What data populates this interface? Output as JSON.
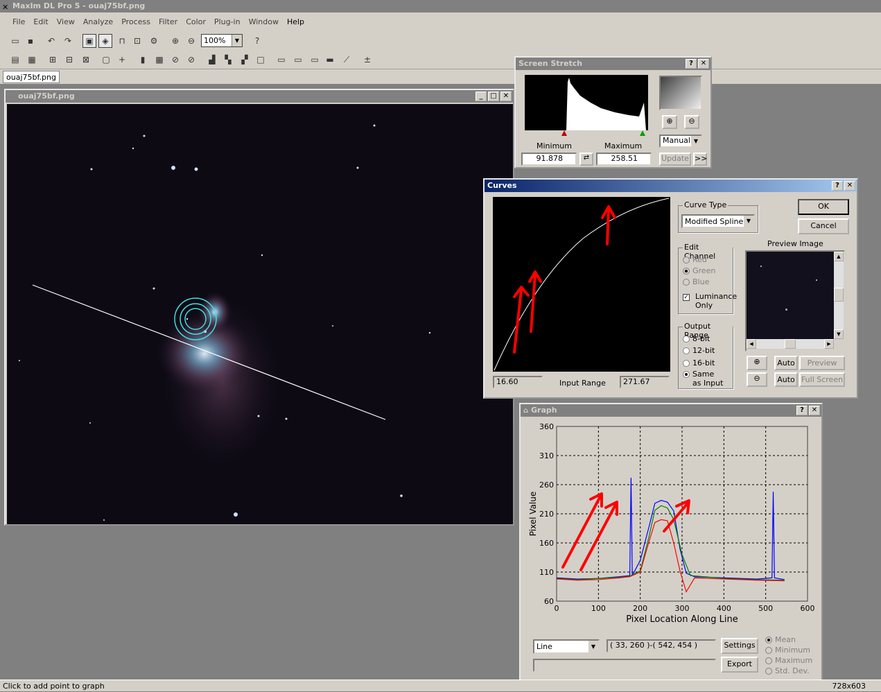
{
  "app": {
    "title": "MaxIm DL Pro 5 - ouaj75bf.png"
  },
  "menu": [
    "File",
    "Edit",
    "View",
    "Analyze",
    "Process",
    "Filter",
    "Color",
    "Plug-in",
    "Window",
    "Help"
  ],
  "toolbar": {
    "zoom": "100%"
  },
  "doc_tab": "ouaj75bf.png",
  "image_window": {
    "title": "ouaj75bf.png"
  },
  "screen_stretch": {
    "title": "Screen Stretch",
    "help": "?",
    "close": "✕",
    "min_label": "Minimum",
    "max_label": "Maximum",
    "min_value": "91.878",
    "max_value": "258.51",
    "mode": "Manual",
    "update": "Update",
    "more": ">>"
  },
  "curves": {
    "title": "Curves",
    "help": "?",
    "close": "✕",
    "curve_type_label": "Curve Type",
    "curve_type": "Modified Spline",
    "ok": "OK",
    "cancel": "Cancel",
    "edit_channel_label": "Edit Channel",
    "channels": [
      "Red",
      "Green",
      "Blue"
    ],
    "luminance_only": "Luminance Only",
    "luminance_line1": "Luminance",
    "luminance_line2": "Only",
    "output_range_label": "Output Range",
    "ranges": [
      "8-bit",
      "12-bit",
      "16-bit"
    ],
    "same_line1": "Same",
    "same_line2": "as Input",
    "preview_label": "Preview Image",
    "auto1": "Auto",
    "auto2": "Auto",
    "preview_btn": "Preview",
    "fullscreen_btn": "Full Screen",
    "input_min": "16.60",
    "input_range_label": "Input Range",
    "input_max": "271.67"
  },
  "graph": {
    "title": "Graph",
    "help": "?",
    "close": "✕",
    "mode": "Line",
    "coords": "( 33, 260 )-( 542, 454 )",
    "settings": "Settings",
    "export": "Export",
    "stats": [
      "Mean",
      "Minimum",
      "Maximum",
      "Std. Dev."
    ]
  },
  "chart_data": {
    "type": "line",
    "xlabel": "Pixel Location Along Line",
    "ylabel": "Pixel Value",
    "xlim": [
      0,
      600
    ],
    "ylim": [
      60,
      360
    ],
    "xticks": [
      "0",
      "100",
      "200",
      "300",
      "400",
      "500",
      "600"
    ],
    "yticks": [
      "60",
      "110",
      "160",
      "210",
      "260",
      "310",
      "360"
    ],
    "grid": true,
    "series": [
      {
        "color": "#0000ff",
        "x": [
          0,
          50,
          100,
          150,
          175,
          178,
          181,
          200,
          220,
          235,
          250,
          265,
          280,
          295,
          310,
          330,
          400,
          480,
          515,
          518,
          521,
          545
        ],
        "y": [
          100,
          98,
          99,
          102,
          104,
          272,
          104,
          130,
          185,
          228,
          233,
          230,
          215,
          150,
          108,
          102,
          100,
          98,
          100,
          248,
          100,
          97
        ]
      },
      {
        "color": "#008000",
        "x": [
          0,
          50,
          100,
          150,
          175,
          200,
          220,
          235,
          250,
          265,
          280,
          300,
          320,
          400,
          480,
          545
        ],
        "y": [
          99,
          97,
          99,
          101,
          103,
          112,
          168,
          216,
          224,
          220,
          200,
          140,
          104,
          99,
          97,
          96
        ]
      },
      {
        "color": "#ff0000",
        "x": [
          0,
          50,
          100,
          150,
          175,
          200,
          220,
          235,
          250,
          265,
          280,
          295,
          310,
          330,
          400,
          480,
          545
        ],
        "y": [
          98,
          96,
          97,
          100,
          102,
          110,
          160,
          195,
          200,
          198,
          160,
          112,
          76,
          100,
          98,
          96,
          95
        ]
      }
    ]
  },
  "status": {
    "left": "Click to add point to graph",
    "right": "728x603"
  }
}
